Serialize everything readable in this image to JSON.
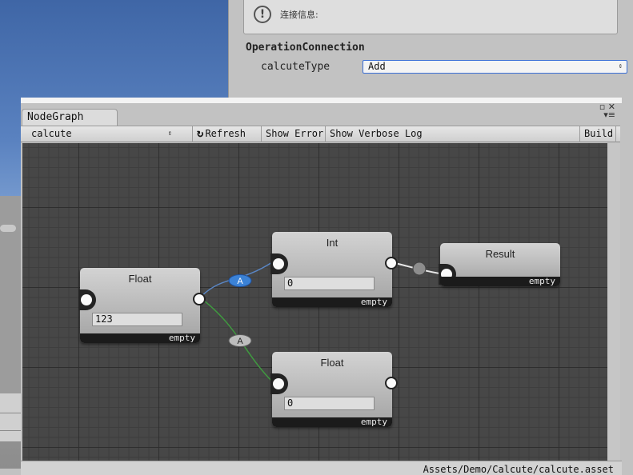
{
  "inspector": {
    "help_text": "连接信息:",
    "section_title": "OperationConnection",
    "prop_label": "calcuteType",
    "prop_value": "Add"
  },
  "window": {
    "tab_title": "NodeGraph",
    "graph_select": "calcute",
    "refresh_label": "Refresh",
    "show_error_label": "Show Error",
    "show_verbose_label": "Show Verbose Log",
    "build_label": "Build",
    "status_path": "Assets/Demo/Calcute/calcute.asset"
  },
  "nodes": {
    "float_a": {
      "title": "Float",
      "value": "123",
      "footer": "empty"
    },
    "int": {
      "title": "Int",
      "value": "0",
      "footer": "empty"
    },
    "result": {
      "title": "Result",
      "footer": "empty"
    },
    "float_b": {
      "title": "Float",
      "value": "0",
      "footer": "empty"
    }
  },
  "connections": [
    {
      "label": "A",
      "color": "#3b82d6",
      "selected": true
    },
    {
      "label": "A",
      "color": "#bdbdbd",
      "selected": false
    }
  ],
  "colors": {
    "link_blue": "#5a86c4",
    "link_green": "#3f9a3f",
    "link_white": "#e8e8e8",
    "canvas_bg": "#474747"
  }
}
